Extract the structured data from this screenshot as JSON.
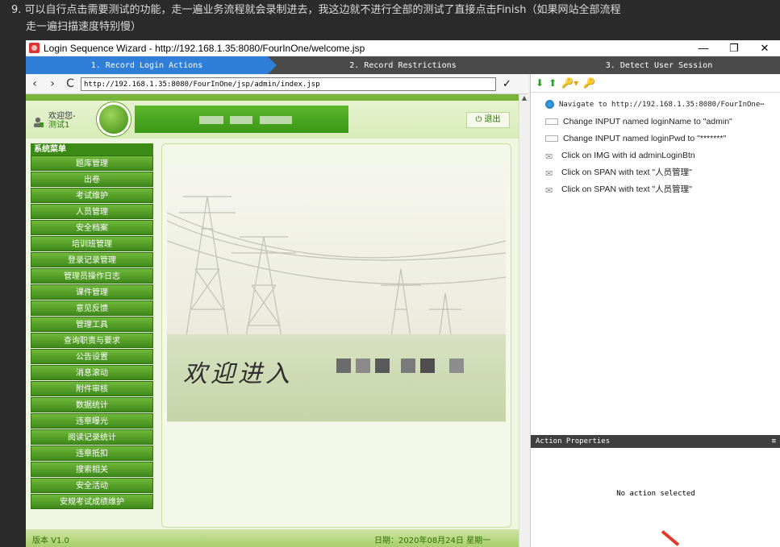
{
  "note": {
    "line1": "9. 可以自行点击需要测试的功能，走一遍业务流程就会录制进去，我这边就不进行全部的测试了直接点击Finish（如果网站全部流程",
    "line2": "走一遍扫描速度特别慢）"
  },
  "window": {
    "title": "Login Sequence Wizard - http://192.168.1.35:8080/FourInOne/welcome.jsp",
    "min": "—",
    "max": "❐",
    "close": "✕"
  },
  "steps": [
    "1. Record Login Actions",
    "2. Record Restrictions",
    "3. Detect User Session"
  ],
  "browser": {
    "back": "‹",
    "forward": "›",
    "refresh": "C",
    "url": "http://192.168.1.35:8080/FourInOne/jsp/admin/index.jsp",
    "go": "✓"
  },
  "site": {
    "welcome_label": "欢迎您-",
    "username": "测试1",
    "logout": "⏻ 退出",
    "menu_title": "系统菜单",
    "menu": [
      "题库管理",
      "出卷",
      "考试维护",
      "人员管理",
      "安全档案",
      "培训班管理",
      "登录记录管理",
      "管理员操作日志",
      "课件管理",
      "意见反馈",
      "管理工具",
      "查询职责与要求",
      "公告设置",
      "消息滚动",
      "附件审核",
      "数据统计",
      "违章曝光",
      "阅读记录统计",
      "违章抵扣",
      "搜索相关",
      "安全活动",
      "安规考试成绩维护"
    ],
    "welcome_text": "欢迎进入",
    "version": "版本 V1.0",
    "date": "日期：2020年08月24日 星期一"
  },
  "recorder": {
    "actions": [
      {
        "icon": "globe-icon",
        "text": "Navigate to http://192.168.1.35:8080/FourInOne⋯"
      },
      {
        "icon": "input-icon",
        "text": "Change INPUT named loginName to \"admin\""
      },
      {
        "icon": "input-icon",
        "text": "Change INPUT named loginPwd to \"*******\""
      },
      {
        "icon": "click-icon",
        "text": "Click on IMG with id adminLoginBtn"
      },
      {
        "icon": "click-icon",
        "text": "Click on SPAN with text \"人员管理\""
      },
      {
        "icon": "click-icon",
        "text": "Click on SPAN with text \"人员管理\""
      }
    ],
    "properties_title": "Action Properties",
    "no_action": "No action selected"
  },
  "colors": {
    "accent": "#2f7ed8",
    "menu_green": "#3f8a1a",
    "step_inactive": "#4a4a4a"
  }
}
